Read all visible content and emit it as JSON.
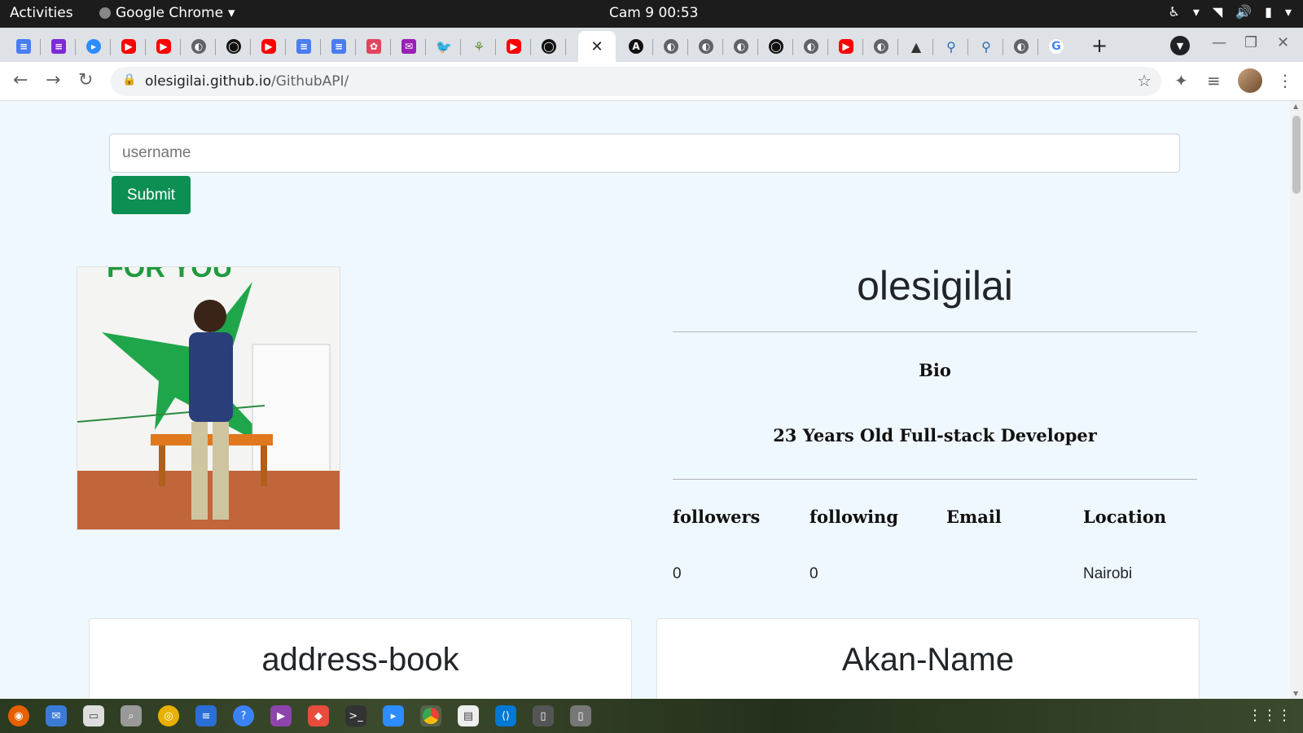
{
  "system": {
    "activities": "Activities",
    "app_name": "Google Chrome",
    "clock": "Cam 9  00:53"
  },
  "browser": {
    "url_host": "olesigilai.github.io",
    "url_path": "/GithubAPI/",
    "tabs": [
      {
        "icon": "docs-icon"
      },
      {
        "icon": "forms-icon"
      },
      {
        "icon": "zoom-icon"
      },
      {
        "icon": "youtube-icon"
      },
      {
        "icon": "youtube-icon"
      },
      {
        "icon": "globe-icon"
      },
      {
        "icon": "github-icon"
      },
      {
        "icon": "youtube-icon"
      },
      {
        "icon": "docs-icon"
      },
      {
        "icon": "docs-icon"
      },
      {
        "icon": "openai-icon"
      },
      {
        "icon": "mail-icon"
      },
      {
        "icon": "twitter-icon"
      },
      {
        "icon": "tree-icon"
      },
      {
        "icon": "youtube-icon"
      },
      {
        "icon": "github-icon"
      },
      {
        "icon": "close-icon",
        "active": true
      },
      {
        "icon": "angular-icon"
      },
      {
        "icon": "globe-icon"
      },
      {
        "icon": "globe-icon"
      },
      {
        "icon": "globe-icon"
      },
      {
        "icon": "github-icon"
      },
      {
        "icon": "globe-icon"
      },
      {
        "icon": "youtube-icon"
      },
      {
        "icon": "globe-icon"
      },
      {
        "icon": "graduation-cap-icon"
      },
      {
        "icon": "figure-icon"
      },
      {
        "icon": "figure-icon"
      },
      {
        "icon": "globe-icon"
      },
      {
        "icon": "google-icon"
      }
    ]
  },
  "search": {
    "placeholder": "username",
    "submit_label": "Submit"
  },
  "profile": {
    "name": "olesigilai",
    "bio_label": "Bio",
    "bio": "23 Years Old Full-stack Developer",
    "stats": {
      "followers_label": "followers",
      "following_label": "following",
      "email_label": "Email",
      "location_label": "Location",
      "followers": "0",
      "following": "0",
      "email": "",
      "location": "Nairobi"
    }
  },
  "repos": [
    {
      "name": "address-book"
    },
    {
      "name": "Akan-Name"
    }
  ],
  "colors": {
    "page_bg": "#f0f8ff",
    "submit_bg": "#0b8f52"
  }
}
